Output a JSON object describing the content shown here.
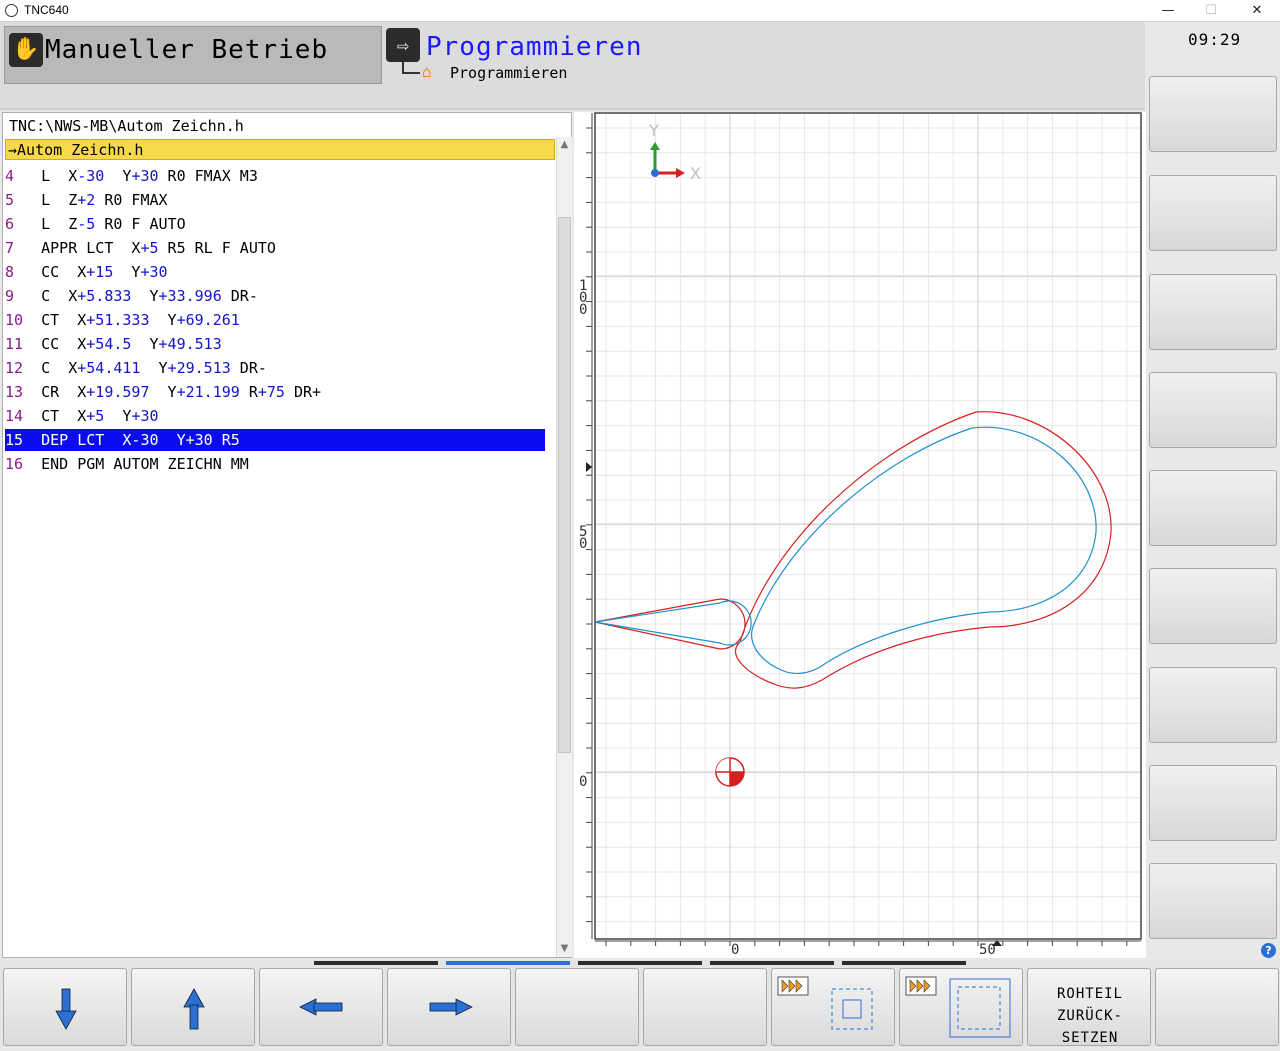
{
  "window": {
    "title": "TNC640",
    "minimize": "—",
    "maximize": "☐",
    "close": "✕"
  },
  "header": {
    "mode_manual": "Manueller Betrieb",
    "mode_program": "Programmieren",
    "mode_program_sub": "Programmieren",
    "clock": "09:29"
  },
  "program": {
    "path": "TNC:\\NWS-MB\\Autom Zeichn.h",
    "active_file": "→Autom Zeichn.h",
    "selected_line": 15,
    "lines": [
      {
        "n": "4",
        "parts": [
          [
            "t",
            "L  "
          ],
          [
            "t",
            "X"
          ],
          [
            "v",
            "-30"
          ],
          [
            "t",
            "  Y"
          ],
          [
            "v",
            "+30"
          ],
          [
            "t",
            " R0 FMAX M3"
          ]
        ]
      },
      {
        "n": "5",
        "parts": [
          [
            "t",
            "L  "
          ],
          [
            "t",
            "Z"
          ],
          [
            "v",
            "+2"
          ],
          [
            "t",
            " R0 FMAX"
          ]
        ]
      },
      {
        "n": "6",
        "parts": [
          [
            "t",
            "L  "
          ],
          [
            "t",
            "Z"
          ],
          [
            "v",
            "-5"
          ],
          [
            "t",
            " R0 F AUTO"
          ]
        ]
      },
      {
        "n": "7",
        "parts": [
          [
            "t",
            "APPR LCT  X"
          ],
          [
            "v",
            "+5"
          ],
          [
            "t",
            " R5 RL F AUTO"
          ]
        ]
      },
      {
        "n": "8",
        "parts": [
          [
            "t",
            "CC  X"
          ],
          [
            "v",
            "+15"
          ],
          [
            "t",
            "  Y"
          ],
          [
            "v",
            "+30"
          ]
        ]
      },
      {
        "n": "9",
        "parts": [
          [
            "t",
            "C  X"
          ],
          [
            "v",
            "+5.833"
          ],
          [
            "t",
            "  Y"
          ],
          [
            "v",
            "+33.996"
          ],
          [
            "t",
            " DR-"
          ]
        ]
      },
      {
        "n": "10",
        "parts": [
          [
            "t",
            "CT  X"
          ],
          [
            "v",
            "+51.333"
          ],
          [
            "t",
            "  Y"
          ],
          [
            "v",
            "+69.261"
          ]
        ]
      },
      {
        "n": "11",
        "parts": [
          [
            "t",
            "CC  X"
          ],
          [
            "v",
            "+54.5"
          ],
          [
            "t",
            "  Y"
          ],
          [
            "v",
            "+49.513"
          ]
        ]
      },
      {
        "n": "12",
        "parts": [
          [
            "t",
            "C  X"
          ],
          [
            "v",
            "+54.411"
          ],
          [
            "t",
            "  Y"
          ],
          [
            "v",
            "+29.513"
          ],
          [
            "t",
            " DR-"
          ]
        ]
      },
      {
        "n": "13",
        "parts": [
          [
            "t",
            "CR  X"
          ],
          [
            "v",
            "+19.597"
          ],
          [
            "t",
            "  Y"
          ],
          [
            "v",
            "+21.199"
          ],
          [
            "t",
            " R"
          ],
          [
            "v",
            "+75"
          ],
          [
            "t",
            " DR+"
          ]
        ]
      },
      {
        "n": "14",
        "parts": [
          [
            "t",
            "CT  X"
          ],
          [
            "v",
            "+5"
          ],
          [
            "t",
            "  Y"
          ],
          [
            "v",
            "+30"
          ]
        ]
      },
      {
        "n": "15",
        "parts": [
          [
            "t",
            "DEP LCT  X-30  Y+30 R5"
          ]
        ]
      },
      {
        "n": "16",
        "parts": [
          [
            "t",
            "END PGM AUTOM ZEICHN MM"
          ]
        ]
      }
    ]
  },
  "graphics": {
    "axis_y": "Y",
    "axis_x": "X",
    "ruler_left": {
      "label_100": "100",
      "label_50": "50",
      "label_0": "0"
    },
    "ruler_bottom": {
      "label_0": "0",
      "label_50": "50"
    },
    "colors": {
      "tool_path": "#1e90d0",
      "contour": "#d42020",
      "grid": "#e6e6e6"
    }
  },
  "softkeys_bottom": {
    "down_icon": "arrow-down-icon",
    "up_icon": "arrow-up-icon",
    "left_icon": "arrow-left-icon",
    "right_icon": "arrow-right-icon",
    "reset_label_1": "ROHTEIL",
    "reset_label_2": "ZURÜCK-",
    "reset_label_3": "SETZEN"
  },
  "help": "?"
}
